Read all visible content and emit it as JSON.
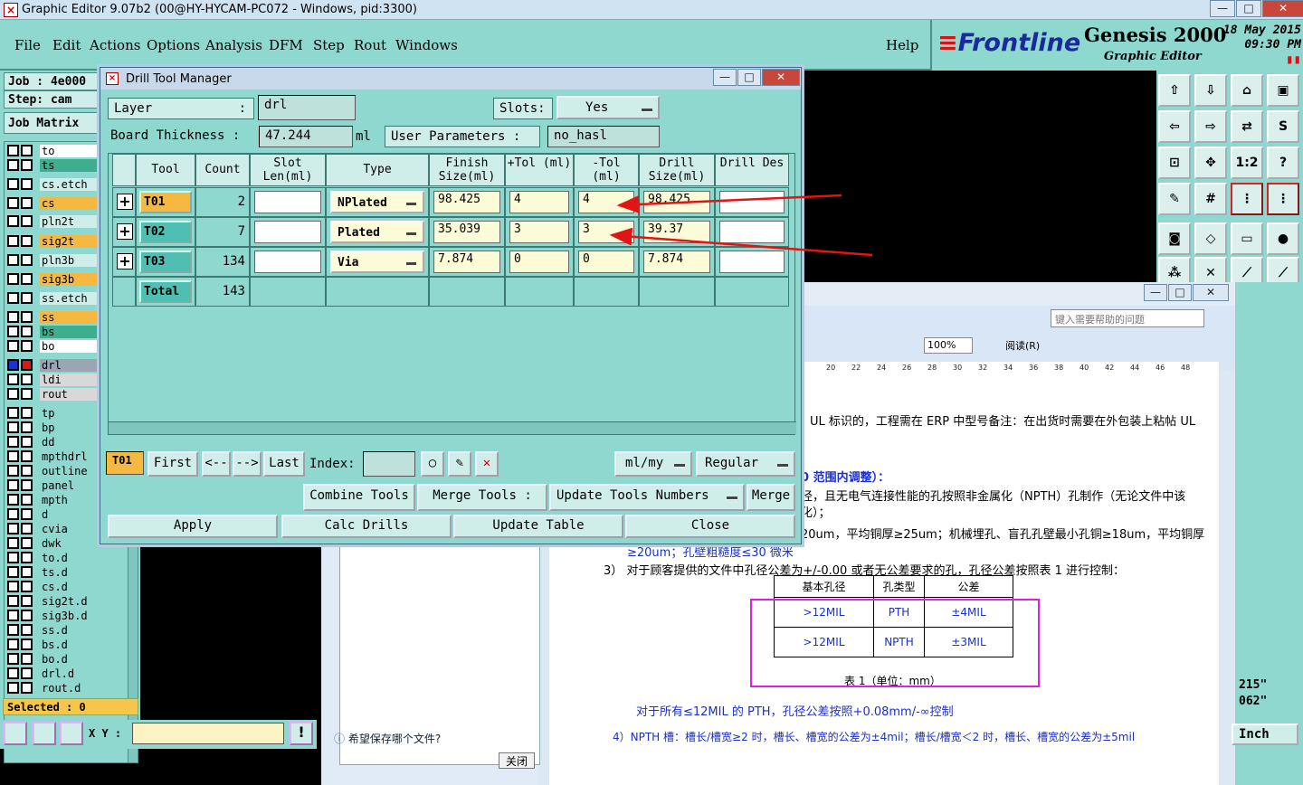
{
  "app": {
    "title": "Graphic Editor 9.07b2 (00@HY-HYCAM-PC072 - Windows, pid:3300)",
    "window_buttons": [
      "—",
      "□",
      "✕"
    ]
  },
  "menu": [
    "File",
    "Edit",
    "Actions",
    "Options",
    "Analysis",
    "DFM",
    "Step",
    "Rout",
    "Windows"
  ],
  "menu_help": "Help",
  "logo": {
    "brand": "Frontline",
    "product": "Genesis 2000",
    "subtitle": "Graphic Editor",
    "date": "18 May 2015",
    "time": "09:30 PM"
  },
  "left": {
    "job": "Job : 4e000",
    "step": "Step: cam",
    "job_matrix": "Job Matrix",
    "selected": "Selected : 0",
    "xy_label": "X Y :",
    "layers": [
      {
        "name": "to",
        "color": "#ffffff"
      },
      {
        "name": "ts",
        "color": "#3fae8e"
      },
      {
        "name": "cs.etch",
        "color": "#cfeeea"
      },
      {
        "name": "cs",
        "color": "#f5b942"
      },
      {
        "name": "pln2t",
        "color": "#cfeeea"
      },
      {
        "name": "sig2t",
        "color": "#f5b942"
      },
      {
        "name": "pln3b",
        "color": "#cfeeea"
      },
      {
        "name": "sig3b",
        "color": "#f5b942"
      },
      {
        "name": "ss.etch",
        "color": "#cfeeea"
      },
      {
        "name": "ss",
        "color": "#f5b942"
      },
      {
        "name": "bs",
        "color": "#3fae8e"
      },
      {
        "name": "bo",
        "color": "#ffffff"
      },
      {
        "name": "drl",
        "color": "#9aa6b0"
      },
      {
        "name": "ldi",
        "color": "#d8d8d8"
      },
      {
        "name": "rout",
        "color": "#d8d8d8"
      },
      {
        "name": "tp",
        "color": "#8fd8d0"
      },
      {
        "name": "bp",
        "color": "#8fd8d0"
      },
      {
        "name": "dd",
        "color": "#8fd8d0"
      },
      {
        "name": "mpthdrl",
        "color": "#8fd8d0"
      },
      {
        "name": "outline",
        "color": "#8fd8d0"
      },
      {
        "name": "panel",
        "color": "#8fd8d0"
      },
      {
        "name": "mpth",
        "color": "#8fd8d0"
      },
      {
        "name": "d",
        "color": "#8fd8d0"
      },
      {
        "name": "cvia",
        "color": "#8fd8d0"
      },
      {
        "name": "dwk",
        "color": "#8fd8d0"
      },
      {
        "name": "to.d",
        "color": "#8fd8d0"
      },
      {
        "name": "ts.d",
        "color": "#8fd8d0"
      },
      {
        "name": "cs.d",
        "color": "#8fd8d0"
      },
      {
        "name": "sig2t.d",
        "color": "#8fd8d0"
      },
      {
        "name": "sig3b.d",
        "color": "#8fd8d0"
      },
      {
        "name": "ss.d",
        "color": "#8fd8d0"
      },
      {
        "name": "bs.d",
        "color": "#8fd8d0"
      },
      {
        "name": "bo.d",
        "color": "#8fd8d0"
      },
      {
        "name": "drl.d",
        "color": "#8fd8d0"
      },
      {
        "name": "rout.d",
        "color": "#8fd8d0"
      }
    ]
  },
  "dialog": {
    "title": "Drill Tool Manager",
    "layer_label": "Layer",
    "layer_colon": ":",
    "layer_value": "drl",
    "slots_label": "Slots:",
    "slots_value": "Yes",
    "thickness_label": "Board Thickness :",
    "thickness_value": "47.244",
    "thickness_unit": "ml",
    "user_params_label": "User Parameters :",
    "user_params_value": "no_hasl",
    "columns": {
      "tool": "Tool",
      "count": "Count",
      "slot": "Slot Len(ml)",
      "type": "Type",
      "finish": "Finish Size(ml)",
      "ptol": "+Tol (ml)",
      "mtol": "-Tol (ml)",
      "drill": "Drill Size(ml)",
      "des": "Drill Des"
    },
    "rows": [
      {
        "tool": "T01",
        "count": "2",
        "type": "NPlated",
        "finish": "98.425",
        "ptol": "4",
        "mtol": "4",
        "drill": "98.425"
      },
      {
        "tool": "T02",
        "count": "7",
        "type": "Plated",
        "finish": "35.039",
        "ptol": "3",
        "mtol": "3",
        "drill": "39.37"
      },
      {
        "tool": "T03",
        "count": "134",
        "type": "Via",
        "finish": "7.874",
        "ptol": "0",
        "mtol": "0",
        "drill": "7.874"
      }
    ],
    "total_label": "Total",
    "total_value": "143",
    "current_tool": "T01",
    "nav": {
      "first": "First",
      "prev": "<--",
      "next": "-->",
      "last": "Last",
      "index": "Index:"
    },
    "units": "ml/my",
    "mode": "Regular",
    "combine": "Combine Tools",
    "merge_tools": "Merge Tools :",
    "update_numbers": "Update Tools Numbers",
    "merge": "Merge",
    "apply": "Apply",
    "calc": "Calc Drills",
    "update_table": "Update Table",
    "close": "Close"
  },
  "word": {
    "help_placeholder": "键入需要帮助的问题",
    "zoom": "100%",
    "read_label": "阅读(R)",
    "ruler": [
      "20",
      "22",
      "24",
      "26",
      "28",
      "30",
      "32",
      "34",
      "36",
      "38",
      "40",
      "42",
      "44",
      "46",
      "48"
    ],
    "lines": {
      "l0": "UL 标识的，工程需在 ERP 中型号备注：在出货时需要在外包装上粘帖 UL",
      "l1": "0 范围内调整）：",
      "l2": "径，且无电气连接性能的孔按照非金属化（NPTH）孔制作（无论文件中该",
      "l3": "化）；",
      "l4": "20um，平均铜厚≥25um；机械埋孔、盲孔孔壁最小孔铜≥18um，平均铜厚",
      "l5": "≥20um；孔壁粗糙度≤30 微米",
      "l6": "3）  对于顾客提供的文件中孔径公差为+/-0.00 或者无公差要求的孔，孔径公差按照表 1 进行控制：",
      "caption": "表 1（单位：mm）",
      "l7": "对于所有≤12MIL 的 PTH，孔径公差按照+0.08mm/-∞控制",
      "l8": "4）NPTH 槽：槽长/槽宽≥2 时，槽长、槽宽的公差为±4mil；槽长/槽宽＜2 时，槽长、槽宽的公差为±5mil"
    },
    "table": {
      "headers": [
        "基本孔径",
        "孔类型",
        "公差"
      ],
      "rows": [
        [
          ">12MIL",
          "PTH",
          "±4MIL"
        ],
        [
          ">12MIL",
          "NPTH",
          "±3MIL"
        ]
      ]
    },
    "save_question": "希望保存哪个文件?",
    "close_btn": "关闭"
  },
  "status_right": {
    "v1": "215\"",
    "v2": "062\"",
    "unit": "Inch"
  }
}
